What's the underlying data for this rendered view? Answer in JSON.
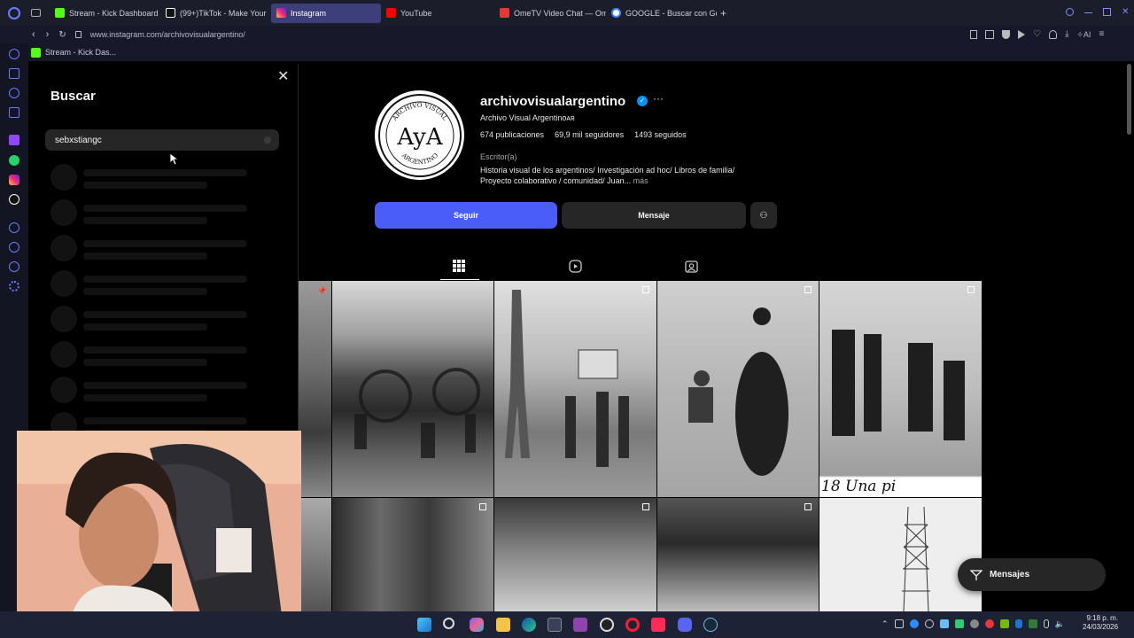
{
  "browser": {
    "tabs": [
      {
        "label": "Stream - Kick Dashboard",
        "color": "#53fc18"
      },
      {
        "label": "(99+)TikTok - Make Your",
        "color": "#ffffff"
      },
      {
        "label": "Instagram",
        "color": "#e1306c"
      },
      {
        "label": "YouTube",
        "color": "#ff0000"
      },
      {
        "label": "OmeTV Video Chat — Om",
        "color": "#e53935"
      },
      {
        "label": "GOOGLE - Buscar con Go",
        "color": "#4285f4"
      }
    ],
    "new_tab": "+",
    "url": "www.instagram.com/archivovisualargentino/",
    "bookmark": "Stream - Kick Das..."
  },
  "search_panel": {
    "title": "Buscar",
    "query": "sebxstiangc",
    "close_icon": "close-icon"
  },
  "profile": {
    "username": "archivovisualargentino",
    "full_name": "Archivo Visual Argentinoᴀʀ",
    "posts": "674 publicaciones",
    "followers": "69,9 mil seguidores",
    "following": "1493 seguidos",
    "category": "Escritor(a)",
    "bio_line1": "Historia visual de los argentinos/ Investigación ad hoc/ Libros de familia/",
    "bio_line2": "Proyecto colaborativo / comunidad/ Juan...",
    "bio_more": "más",
    "follow_label": "Seguir",
    "message_label": "Mensaje",
    "avatar_text": "AyA",
    "avatar_top": "ARCHIVO VISUAL",
    "avatar_bottom": "ARGENTINO"
  },
  "posts_caption_overlay": "18 Una pi",
  "messages_pill": "Mensajes",
  "clock": {
    "time": "9:18 p. m.",
    "date": "24/03/2026"
  },
  "colors": {
    "accent": "#4a5df9",
    "bg": "#000000"
  }
}
